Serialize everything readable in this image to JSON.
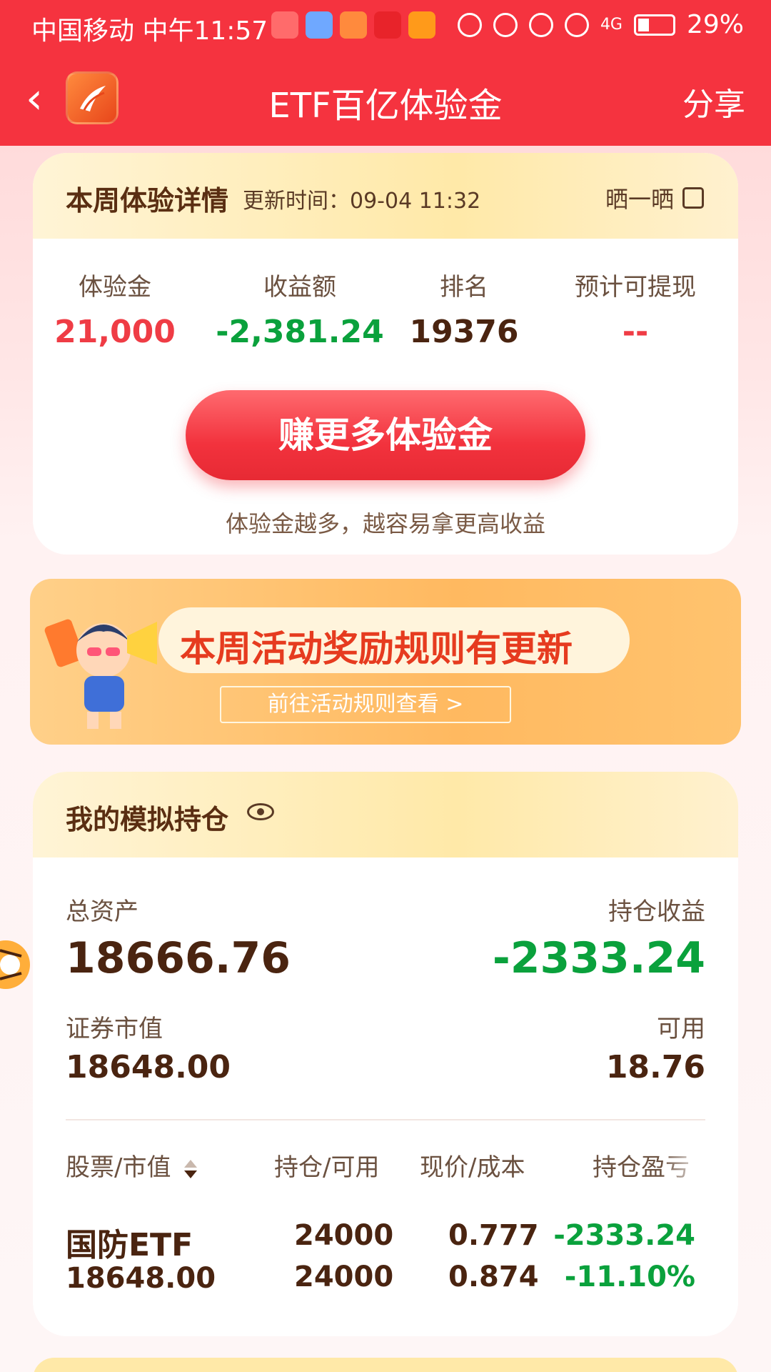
{
  "status_bar": {
    "carrier_time": "中国移动 中午11:57",
    "battery": "29%",
    "network": "4G"
  },
  "header": {
    "title": "ETF百亿体验金",
    "share": "分享"
  },
  "weekly_card": {
    "title": "本周体验详情",
    "update_time": "更新时间：09-04 11:32",
    "share_label": "晒一晒",
    "stats": [
      {
        "label": "体验金",
        "value": "21,000"
      },
      {
        "label": "收益额",
        "value": "-2,381.24"
      },
      {
        "label": "排名",
        "value": "19376"
      },
      {
        "label": "预计可提现",
        "value": "--"
      }
    ],
    "earn_button": "赚更多体验金",
    "earn_hint": "体验金越多，越容易拿更高收益"
  },
  "banner": {
    "title": "本周活动奖励规则有更新",
    "link": "前往活动规则查看 >"
  },
  "holdings_card": {
    "title": "我的模拟持仓",
    "total_assets_label": "总资产",
    "total_assets": "18666.76",
    "position_profit_label": "持仓收益",
    "position_profit": "-2333.24",
    "market_value_label": "证券市值",
    "market_value": "18648.00",
    "available_label": "可用",
    "available": "18.76",
    "table_headers": {
      "stock": "股票/市值",
      "position": "持仓/可用",
      "price": "现价/成本",
      "pnl": "持仓盈亏"
    },
    "rows": [
      {
        "name": "国防ETF",
        "market_value": "18648.00",
        "position": "24000",
        "available": "24000",
        "price": "0.777",
        "cost": "0.874",
        "pnl": "-2333.24",
        "pnl_pct": "-11.10%"
      }
    ]
  },
  "colors": {
    "brand_red": "#f5333f",
    "gain_green": "#0aa13c",
    "text_brown": "#4a2410"
  }
}
